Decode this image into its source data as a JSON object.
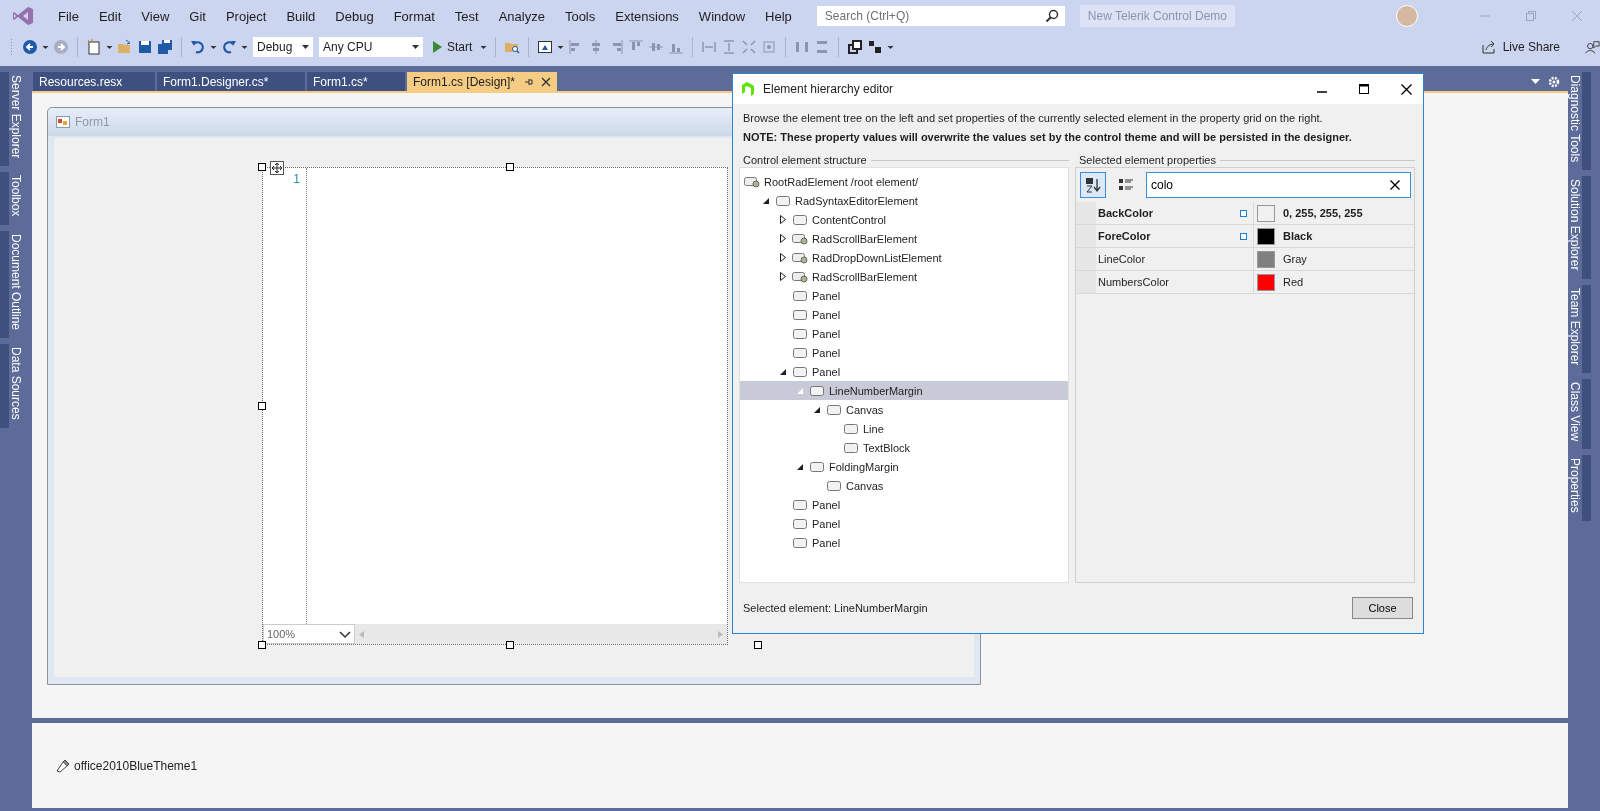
{
  "menu_bar": {
    "items": [
      "File",
      "Edit",
      "View",
      "Git",
      "Project",
      "Build",
      "Debug",
      "Format",
      "Test",
      "Analyze",
      "Tools",
      "Extensions",
      "Window",
      "Help"
    ],
    "search": {
      "placeholder": "Search (Ctrl+Q)"
    },
    "solution_name": "New Telerik Control Demo"
  },
  "toolbar": {
    "configuration": "Debug",
    "platform": "Any CPU",
    "start": "Start",
    "live_share": "Live Share"
  },
  "left_tool_tabs": [
    "Server Explorer",
    "Toolbox",
    "Document Outline",
    "Data Sources"
  ],
  "right_tool_tabs": [
    "Diagnostic Tools",
    "Solution Explorer",
    "Team Explorer",
    "Class View",
    "Properties"
  ],
  "document_tabs": [
    {
      "label": "Resources.resx",
      "selected": false
    },
    {
      "label": "Form1.Designer.cs*",
      "selected": false
    },
    {
      "label": "Form1.cs*",
      "selected": false
    },
    {
      "label": "Form1.cs [Design]*",
      "selected": true
    }
  ],
  "designer": {
    "form_title": "Form1",
    "line_number": "1",
    "zoom": "100%"
  },
  "component_tray": {
    "items": [
      "office2010BlueTheme1"
    ]
  },
  "dialog": {
    "title": "Element hierarchy editor",
    "description": "Browse the element tree on the left and set properties of the currently selected element in the property grid on the right.",
    "note": "NOTE: These property values will overwrite the values set by the control theme and will be persisted in the designer.",
    "tree_title": "Control element structure",
    "tree": [
      {
        "label": "RootRadElement /root element/",
        "kind": "component",
        "selected": false,
        "children": [
          {
            "label": "RadSyntaxEditorElement",
            "kind": "panel",
            "expanded": true,
            "selected": false,
            "children": [
              {
                "label": "ContentControl",
                "kind": "panel",
                "expanded": false,
                "selected": false
              },
              {
                "label": "RadScrollBarElement",
                "kind": "component",
                "expanded": false,
                "selected": false
              },
              {
                "label": "RadDropDownListElement",
                "kind": "component",
                "expanded": false,
                "selected": false
              },
              {
                "label": "RadScrollBarElement",
                "kind": "component",
                "expanded": false,
                "selected": false
              },
              {
                "label": "Panel",
                "kind": "panel",
                "selected": false
              },
              {
                "label": "Panel",
                "kind": "panel",
                "selected": false
              },
              {
                "label": "Panel",
                "kind": "panel",
                "selected": false
              },
              {
                "label": "Panel",
                "kind": "panel",
                "selected": false
              },
              {
                "label": "Panel",
                "kind": "panel",
                "expanded": true,
                "selected": false,
                "children": [
                  {
                    "label": "LineNumberMargin",
                    "kind": "panel",
                    "expanded": true,
                    "selected": true,
                    "children": [
                      {
                        "label": "Canvas",
                        "kind": "panel",
                        "expanded": true,
                        "selected": false,
                        "children": [
                          {
                            "label": "Line",
                            "kind": "panel",
                            "selected": false
                          },
                          {
                            "label": "TextBlock",
                            "kind": "panel",
                            "selected": false
                          }
                        ]
                      }
                    ]
                  },
                  {
                    "label": "FoldingMargin",
                    "kind": "panel",
                    "expanded": true,
                    "selected": false,
                    "children": [
                      {
                        "label": "Canvas",
                        "kind": "panel",
                        "selected": false
                      }
                    ]
                  }
                ]
              },
              {
                "label": "Panel",
                "kind": "panel",
                "selected": false
              },
              {
                "label": "Panel",
                "kind": "panel",
                "selected": false
              },
              {
                "label": "Panel",
                "kind": "panel",
                "selected": false
              }
            ]
          }
        ]
      }
    ],
    "properties_title": "Selected element properties",
    "filter": {
      "value": "colo"
    },
    "properties": [
      {
        "name": "BackColor",
        "value": "0, 255, 255, 255",
        "color": "#f0f0f0",
        "modified": true
      },
      {
        "name": "ForeColor",
        "value": "Black",
        "color": "#000000",
        "modified": true
      },
      {
        "name": "LineColor",
        "value": "Gray",
        "color": "#808080",
        "modified": false
      },
      {
        "name": "NumbersColor",
        "value": "Red",
        "color": "#ff0000",
        "modified": false
      }
    ],
    "selected_label": "Selected element: LineNumberMargin",
    "close": "Close"
  }
}
